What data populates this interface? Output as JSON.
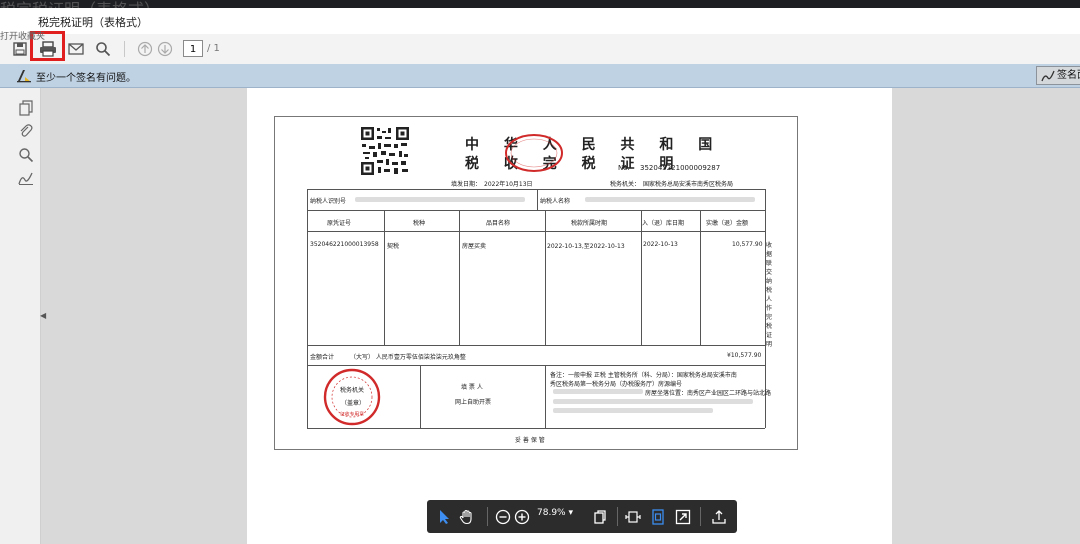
{
  "window": {
    "ghost_title": "税完税证明（表格式）",
    "title": "税完税证明（表格式）",
    "tooltip": "打开收藏夹"
  },
  "toolbar": {
    "page_number": "1",
    "page_total": "/ 1",
    "icons": [
      "save-icon",
      "print-icon",
      "mail-icon",
      "search-icon",
      "up-arrow-icon",
      "down-arrow-icon"
    ]
  },
  "signature_bar": {
    "message": "至少一个签名有问题。",
    "button_label": "签名面板"
  },
  "certificate": {
    "title_line1": "中 华 人 民 共 和 国",
    "title_line2": "税 收 完 税 证 明",
    "no_label": "No.",
    "no_value": "352045221000009287",
    "fill_date": "填发日期：　2022年10月13日",
    "tax_authority": "税务机关：　国家税务总局安溪市南秀区税务局",
    "taxpayer_id_label": "纳税人识别号",
    "taxpayer_name_label": "纳税人名称",
    "headers": [
      "原凭证号",
      "税种",
      "品目名称",
      "税款所属时期",
      "入（退）库日期",
      "实缴（退）金额"
    ],
    "row": {
      "voucher": "352046221000013958",
      "tax_type": "契税",
      "item": "房屋买卖",
      "period": "2022-10-13,至2022-10-13",
      "date": "2022-10-13",
      "amount": "10,577.90"
    },
    "side_note": "收据联 交纳税人作完税证明",
    "total_label": "金额合计",
    "total_text": "（大写） 人民币壹万零伍佰柒拾柒元玖角整",
    "total_value": "¥10,577.90",
    "stamp_text": "税务机关",
    "stamp_sub": "（盖章）",
    "stamp_small": "征收专用章",
    "filler_label": "填 票 人",
    "filler_value": "网上自助开票",
    "remark_line1": "备注：一般申报 正税 主管税务所（科、分局）：国家税务总局安溪市南",
    "remark_line2": "秀区税务局第一税务分局（办税服务厅）房源编号",
    "remark_line3": "房屋坐落位置：南秀区产业园区二环路与站北路",
    "footer": "妥 善 保 管"
  },
  "float_toolbar": {
    "zoom": "78.9%",
    "icons": [
      "pointer-icon",
      "hand-icon",
      "zoom-out-icon",
      "zoom-in-icon",
      "page-icon",
      "fit-width-icon",
      "fit-page-icon",
      "fullscreen-icon",
      "share-icon"
    ]
  },
  "colors": {
    "accent_red": "#e01e1e",
    "stamp_red": "#d12a2a",
    "signature_bar": "#bfd2e4",
    "float_toolbar": "#2c2c2c",
    "select_blue": "#3d8ef0"
  }
}
